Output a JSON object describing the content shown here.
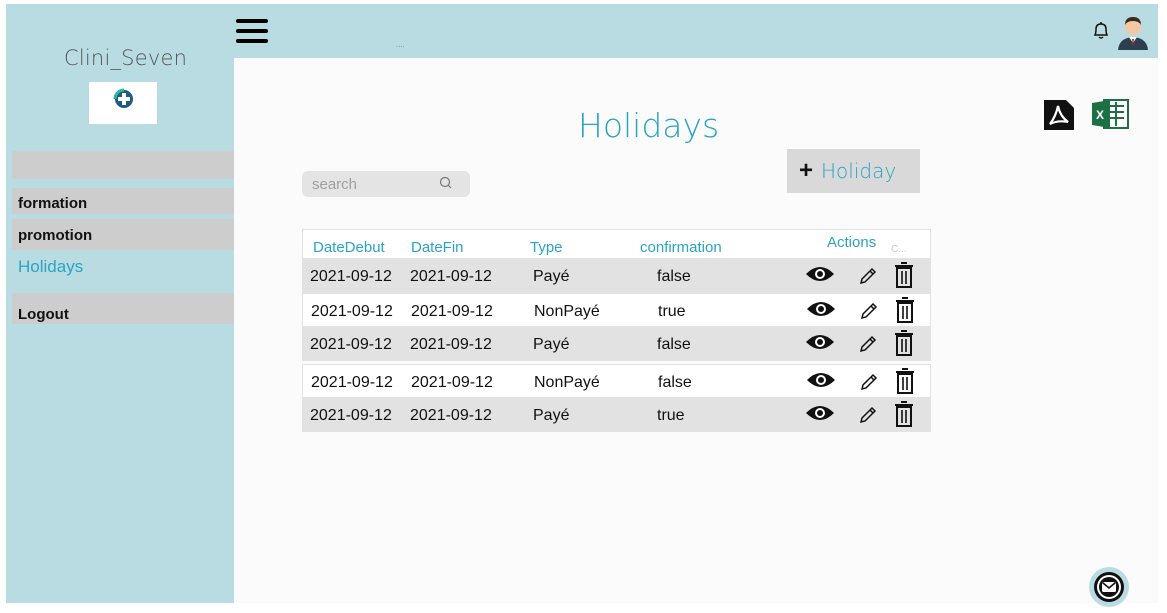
{
  "app": {
    "brand": "Clini_Seven",
    "topbar_dots": "...."
  },
  "sidebar": {
    "items": [
      {
        "label": "formation"
      },
      {
        "label": "promotion"
      },
      {
        "label": "Holidays"
      }
    ],
    "logout_label": "Logout"
  },
  "page": {
    "title": "Holidays",
    "search_placeholder": "search",
    "add_button_plus": "+",
    "add_button_label": "Holiday"
  },
  "table": {
    "headers": [
      "DateDebut",
      "DateFin",
      "Type",
      "confirmation",
      "Actions"
    ],
    "header_ghost": "C...",
    "rows": [
      [
        "2021-09-12",
        "2021-09-12",
        "Payé",
        "false"
      ],
      [
        "2021-09-12",
        "2021-09-12",
        "NonPayé",
        "true"
      ],
      [
        "2021-09-12",
        "2021-09-12",
        "Payé",
        "false"
      ],
      [
        "2021-09-12",
        "2021-09-12",
        "NonPayé",
        "false"
      ],
      [
        "2021-09-12",
        "2021-09-12",
        "Payé",
        "true"
      ]
    ]
  },
  "icons": {
    "menu": "hamburger-menu-icon",
    "notification": "bell-icon",
    "user": "user-avatar-icon",
    "logo": "medical-cross-logo-icon",
    "export_pdf": "pdf-icon",
    "export_excel": "excel-icon",
    "search": "search-icon",
    "view": "eye-icon",
    "edit": "pencil-icon",
    "delete": "trash-icon",
    "mail": "mail-icon"
  },
  "colors": {
    "sidebar_bg": "#b9dce2",
    "accent": "#2aa4c4",
    "row_gray": "#e2e2e2",
    "button_gray": "#d9d9d9"
  }
}
